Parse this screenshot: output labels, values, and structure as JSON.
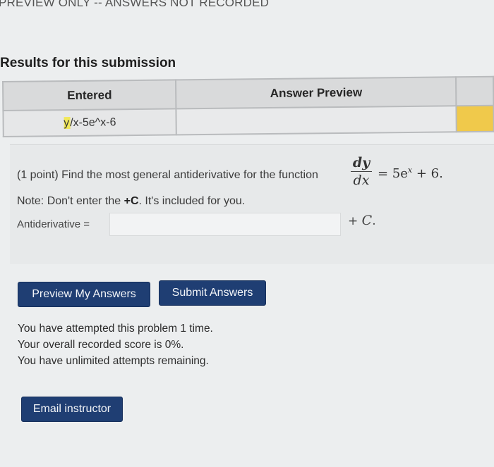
{
  "banner": "PREVIEW ONLY -- ANSWERS NOT RECORDED",
  "results": {
    "title": "Results for this submission",
    "columns": [
      "Entered",
      "Answer Preview"
    ],
    "rows": [
      {
        "entered_highlight": "y",
        "entered_rest": "/x-5e^x-6",
        "preview": ""
      }
    ]
  },
  "problem": {
    "question": "(1 point) Find the most general antiderivative for the function",
    "derivative_num": "dy",
    "derivative_den": "dx",
    "rhs_pre": "= 5e",
    "rhs_exp": "x",
    "rhs_post": " + 6.",
    "note_pre": "Note: Don't enter the ",
    "note_bold": "+C",
    "note_post": ". It's included for you.",
    "answer_label": "Antiderivative =",
    "answer_value": "",
    "plus_prefix": "+ ",
    "plus_c": "C",
    "plus_suffix": "."
  },
  "buttons": {
    "preview": "Preview My Answers",
    "submit": "Submit Answers",
    "email": "Email instructor"
  },
  "attempts": [
    "You have attempted this problem 1 time.",
    "Your overall recorded score is 0%.",
    "You have unlimited attempts remaining."
  ],
  "colors": {
    "button_bg": "#1f3e73",
    "highlight_cell": "#f0c94b",
    "highlight_text": "#f1e85a"
  }
}
